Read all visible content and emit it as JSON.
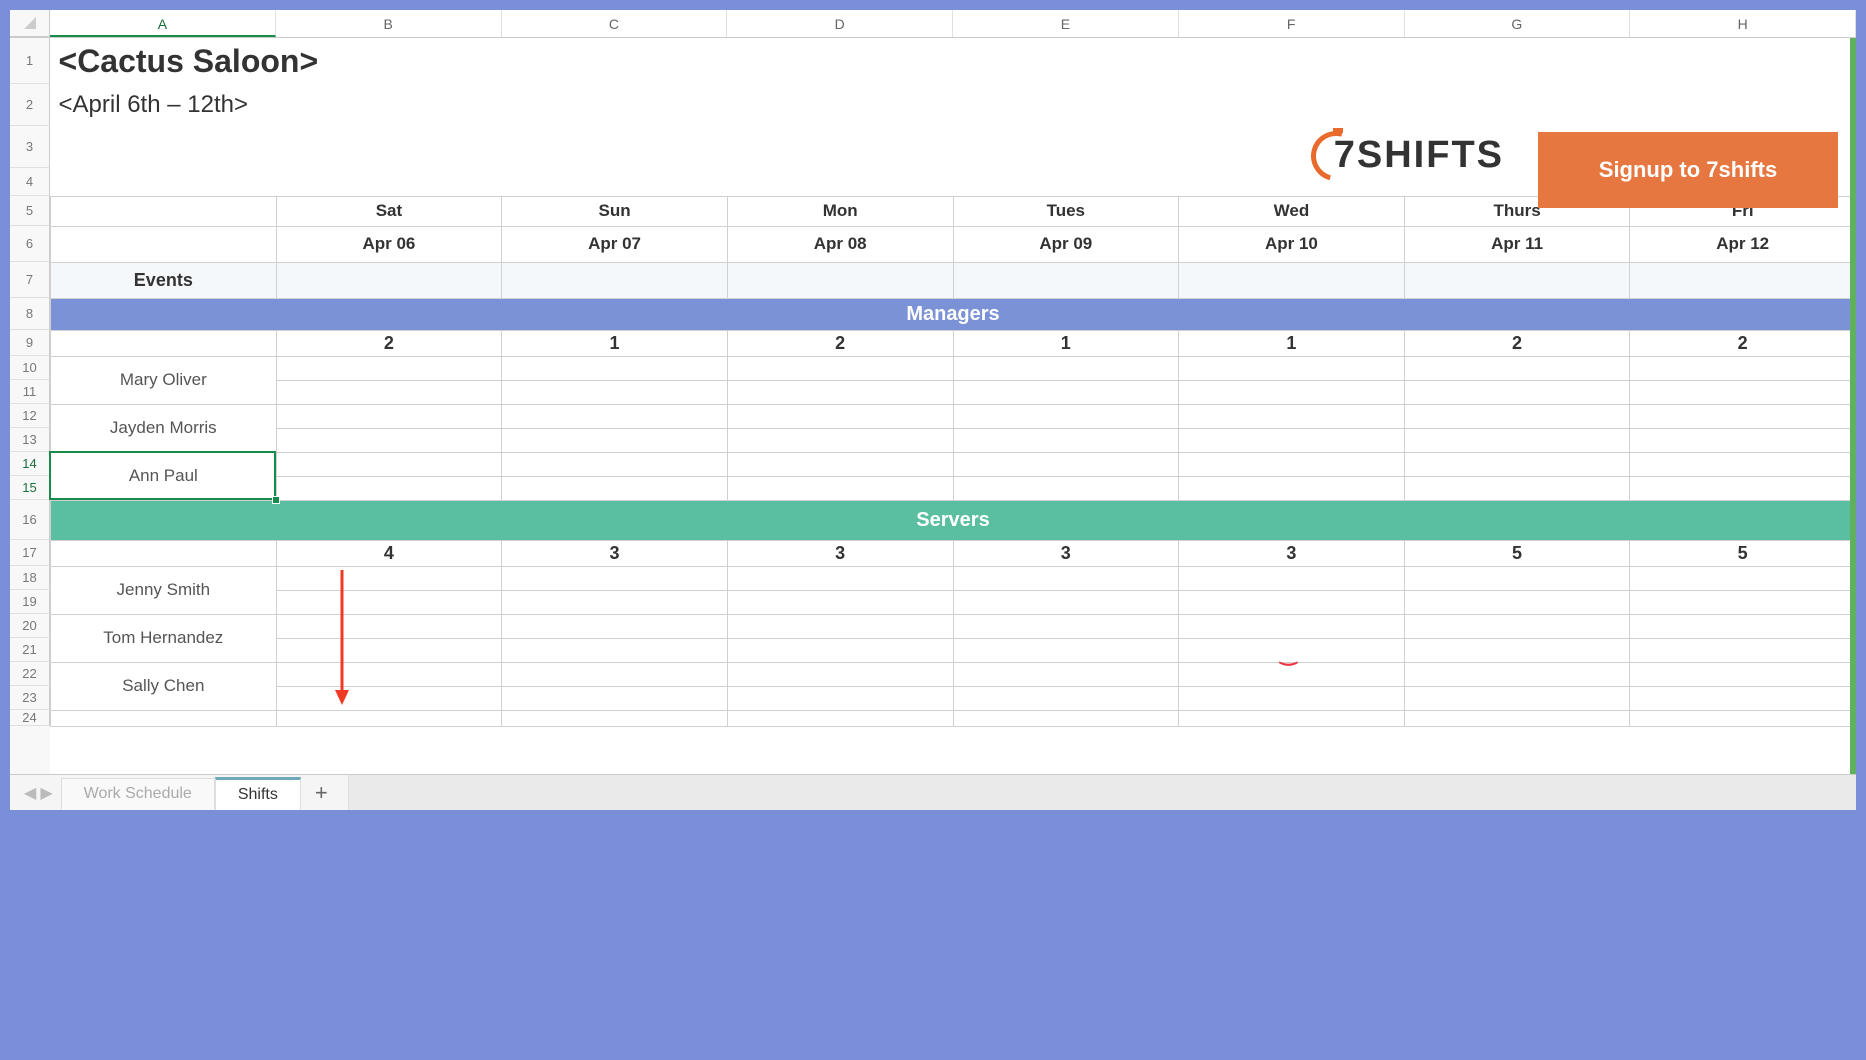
{
  "columns": [
    "A",
    "B",
    "C",
    "D",
    "E",
    "F",
    "G",
    "H"
  ],
  "rows": [
    1,
    2,
    3,
    4,
    5,
    6,
    7,
    8,
    9,
    10,
    11,
    12,
    13,
    14,
    15,
    16,
    17,
    18,
    19,
    20,
    21,
    22,
    23,
    24
  ],
  "title": "<Cactus Saloon>",
  "subtitle": "<April 6th – 12th>",
  "days": [
    "Sat",
    "Sun",
    "Mon",
    "Tues",
    "Wed",
    "Thurs",
    "Fri"
  ],
  "dates": [
    "Apr 06",
    "Apr 07",
    "Apr 08",
    "Apr 09",
    "Apr 10",
    "Apr 11",
    "Apr 12"
  ],
  "eventsLabel": "Events",
  "sections": {
    "managers": {
      "label": "Managers",
      "counts": [
        "2",
        "1",
        "2",
        "1",
        "1",
        "2",
        "2"
      ],
      "people": [
        "Mary Oliver",
        "Jayden Morris",
        "Ann Paul"
      ]
    },
    "servers": {
      "label": "Servers",
      "counts": [
        "4",
        "3",
        "3",
        "3",
        "3",
        "5",
        "5"
      ],
      "people": [
        "Jenny Smith",
        "Tom Hernandez",
        "Sally Chen"
      ]
    }
  },
  "logoText": "7SHIFTS",
  "signupLabel": "Signup to 7shifts",
  "tabs": {
    "items": [
      "Work Schedule",
      "Shifts"
    ],
    "activeIndex": 1
  },
  "activeColumn": "A",
  "selectedRows": [
    14,
    15
  ]
}
